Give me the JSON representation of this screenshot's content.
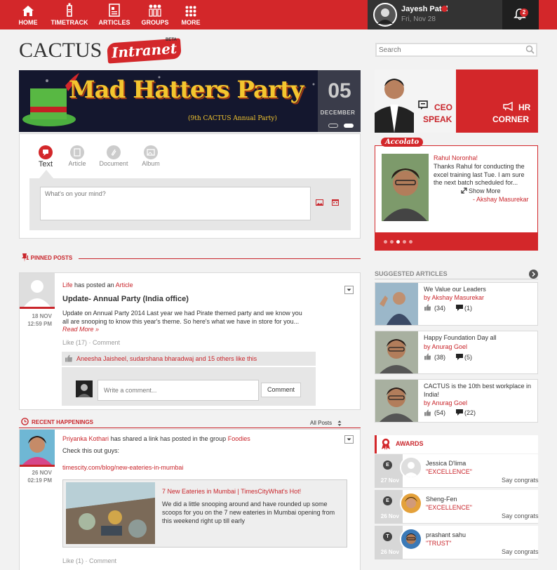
{
  "nav": {
    "home": "HOME",
    "timetrack": "TIMETRACK",
    "articles": "ARTICLES",
    "groups": "GROUPS",
    "more": "MORE"
  },
  "user": {
    "name": "Jayesh Patel",
    "date": "Fri, Nov 28",
    "notifications": "2"
  },
  "brand": {
    "logo": "CACTUS",
    "script": "Intranet",
    "beta": "BETA"
  },
  "search": {
    "placeholder": "Search"
  },
  "banner": {
    "title": "Mad Hatters Party",
    "subtitle": "(9th CACTUS Annual Party)",
    "day": "05",
    "month": "DECEMBER"
  },
  "composer": {
    "tabs": [
      "Text",
      "Article",
      "Document",
      "Album"
    ],
    "placeholder": "What's on your mind?"
  },
  "pinned": {
    "heading": "1 PINNED POSTS",
    "post": {
      "author": "Life",
      "action": "has posted an",
      "type": "Article",
      "title": "Update- Annual Party (India office)",
      "body": "Update on Annual Party 2014  Last year we had Pirate themed party and we know you all are snooping to know this year's theme.   So here's what we have in store for you...",
      "read_more": "Read More »",
      "date": "18 NOV",
      "time": "12:59 PM",
      "like": "Like (17)",
      "sep": "·",
      "comment": "Comment",
      "likers": "Aneesha Jaisheel, sudarshana bharadwaj and 15 others like this",
      "comment_placeholder": "Write a comment...",
      "comment_btn": "Comment"
    }
  },
  "recent": {
    "heading": "RECENT HAPPENINGS",
    "filter": "All Posts",
    "post": {
      "author": "Priyanka Kothari",
      "action": "has shared a link has posted in the group",
      "group": "Foodies",
      "body": "Check this out guys:",
      "link": "timescity.com/blog/new-eateries-in-mumbai",
      "date": "26 NOV",
      "time": "02:19 PM",
      "preview_title": "7 New Eateries in Mumbai | TimesCityWhat's Hot!",
      "preview_body": "We did a little snooping around and have rounded up some scoops for you on the 7 new eateries in Mumbai opening from this weekend right up till early",
      "like": "Like (1)",
      "sep": "·",
      "comment": "Comment"
    }
  },
  "ceo": {
    "ceo_line1": "CEO",
    "ceo_line2": "SPEAK",
    "hr_line1": "HR",
    "hr_line2": "CORNER"
  },
  "accolade": {
    "tag": "Accolato",
    "to": "Rahul Noronha!",
    "text": "Thanks Rahul for conducting the excel training last Tue. I am sure the next batch scheduled for...",
    "more": "Show More",
    "from": "- Akshay Masurekar"
  },
  "suggested": {
    "heading": "SUGGESTED ARTICLES",
    "items": [
      {
        "title": "We Value our Leaders",
        "author": "by Akshay Masurekar",
        "likes": "(34)",
        "comments": "(1)"
      },
      {
        "title": "Happy Foundation Day all",
        "author": "by Anurag Goel",
        "likes": "(38)",
        "comments": "(5)"
      },
      {
        "title": "CACTUS is the 10th best workplace in India!",
        "author": "by Anurag Goel",
        "likes": "(54)",
        "comments": "(22)"
      }
    ]
  },
  "awards": {
    "heading": "AWARDS",
    "items": [
      {
        "name": "Jessica D'lima",
        "award": "\"EXCELLENCE\"",
        "date": "27 Nov",
        "action": "Say congrats",
        "badge": "E"
      },
      {
        "name": "Sheng-Fen",
        "award": "\"EXCELLENCE\"",
        "date": "26 Nov",
        "action": "Say congrats",
        "badge": "E"
      },
      {
        "name": "prashant sahu",
        "award": "\"TRUST\"",
        "date": "26 Nov",
        "action": "Say congrats",
        "badge": "T"
      }
    ]
  },
  "colors": {
    "brand": "#d3272a",
    "dark": "#333333"
  }
}
